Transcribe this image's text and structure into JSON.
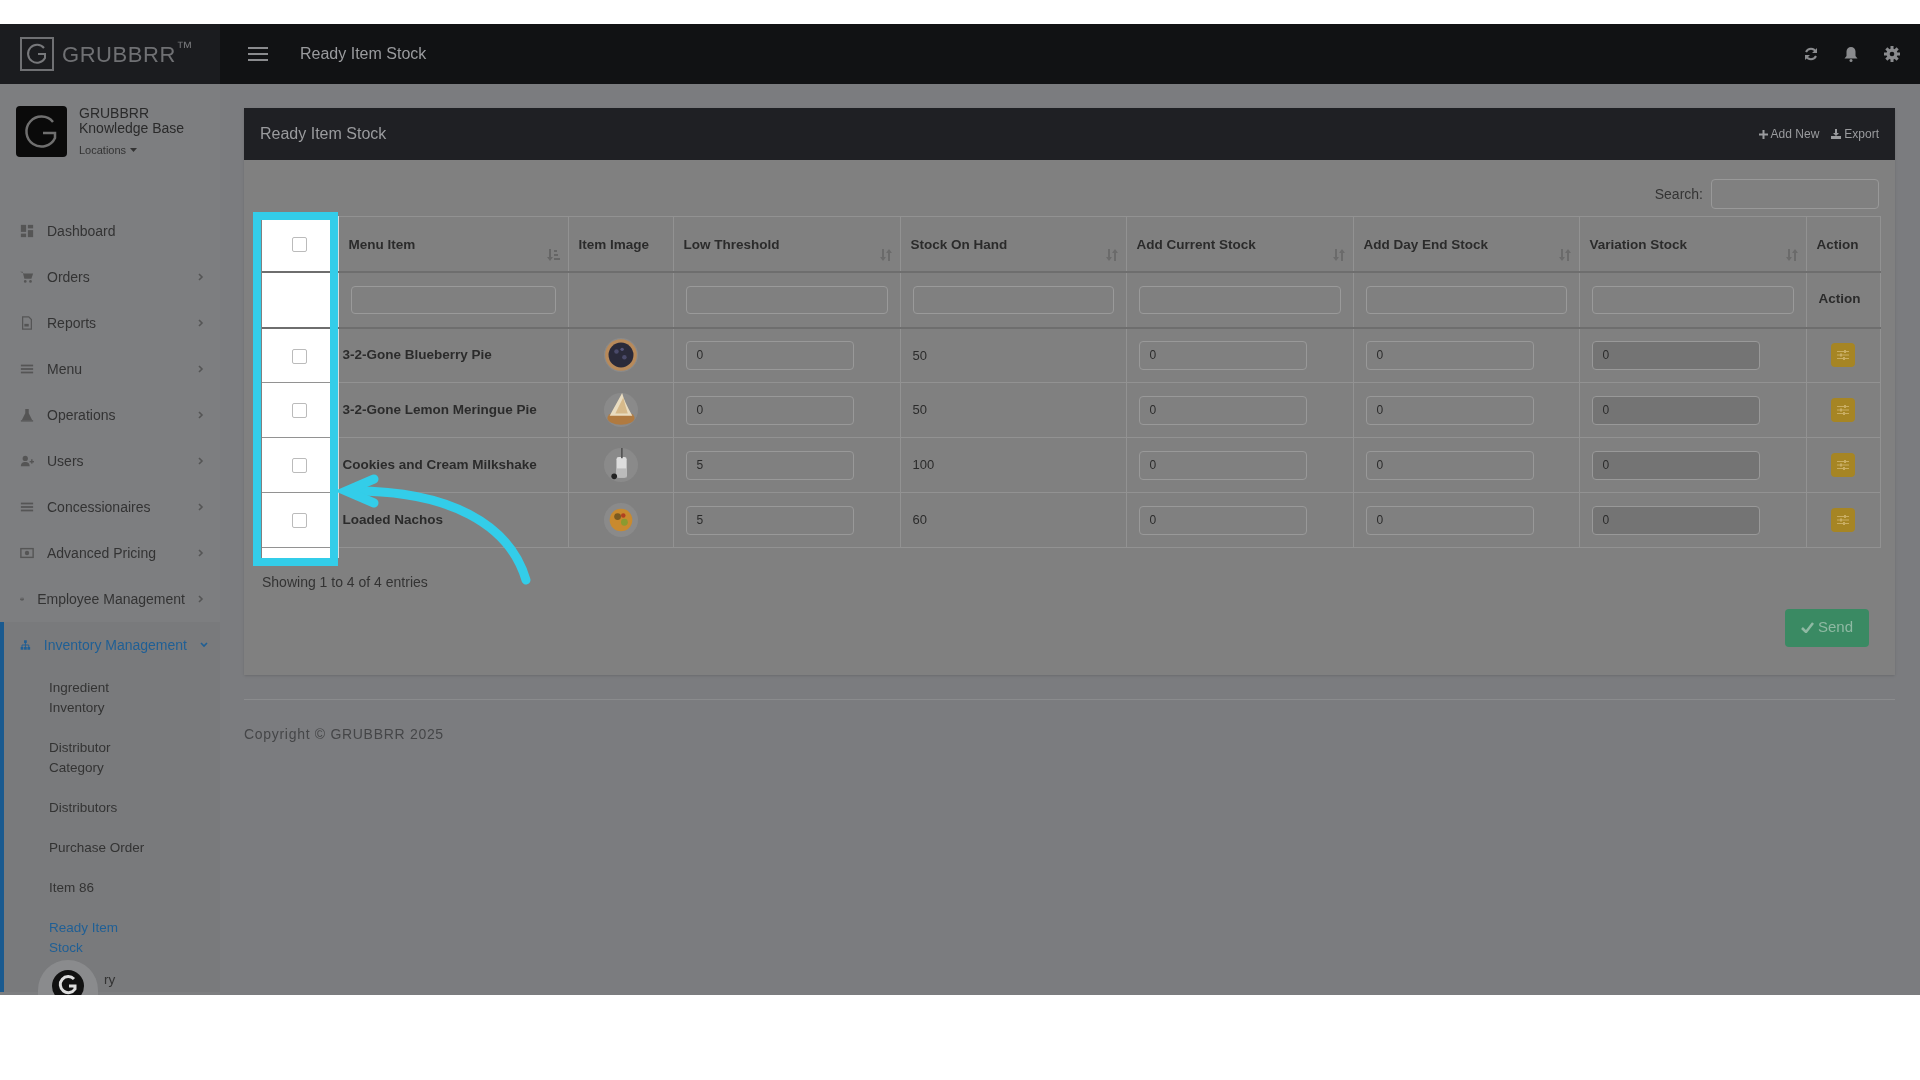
{
  "brand": {
    "logo_text": "GRUBBRR$^{™}$"
  },
  "profile": {
    "name": "GRUBBRR Knowledge Base",
    "locations": "Locations"
  },
  "sidebar": {
    "items": [
      {
        "label": "Dashboard",
        "selected": false
      },
      {
        "label": "Orders",
        "selected": false
      },
      {
        "label": "Reports",
        "selected": false
      },
      {
        "label": "Menu",
        "selected": false
      },
      {
        "label": "Operations",
        "selected": false
      },
      {
        "label": "Users",
        "selected": false
      },
      {
        "label": "Concessionaires",
        "selected": false
      },
      {
        "label": "Advanced Pricing",
        "selected": false
      },
      {
        "label": "Employee Management",
        "selected": false
      },
      {
        "label": "Inventory Management",
        "selected": true,
        "children": [
          {
            "label": "Ingredient Inventory",
            "selected": false
          },
          {
            "label": "Distributor Category",
            "selected": false
          },
          {
            "label": "Distributors",
            "selected": false
          },
          {
            "label": "Purchase Order",
            "selected": false
          },
          {
            "label": "Item 86",
            "selected": false
          },
          {
            "label": "Ready Item Stock",
            "selected": true
          },
          {
            "label": "ry",
            "selected": false
          }
        ]
      }
    ]
  },
  "topbar": {
    "title": "Ready Item Stock"
  },
  "panel": {
    "title": "Ready Item Stock",
    "actions": [
      {
        "label": "Add New"
      },
      {
        "label": "Export"
      }
    ],
    "search": {
      "label": "Search:"
    },
    "table": {
      "select_all": {
        "checked": false
      },
      "columns": [
        {
          "label": "Menu Item"
        },
        {
          "label": "Item Image"
        },
        {
          "label": "Low Threshold"
        },
        {
          "label": "Stock On Hand"
        },
        {
          "label": "Add Current Stock"
        },
        {
          "label": "Add Day End Stock"
        },
        {
          "label": "Variation Stock"
        },
        {
          "label": "Action"
        }
      ],
      "filter_action_label": "Action",
      "rows": [
        {
          "checked": false,
          "menu_item": "3-2-Gone Blueberry Pie",
          "low_threshold": "0",
          "stock_on_hand": "50",
          "add_current_stock": "0",
          "add_day_end_stock": "0",
          "variation_stock": "0"
        },
        {
          "checked": false,
          "menu_item": "3-2-Gone Lemon Meringue Pie",
          "low_threshold": "0",
          "stock_on_hand": "50",
          "add_current_stock": "0",
          "add_day_end_stock": "0",
          "variation_stock": "0"
        },
        {
          "checked": false,
          "menu_item": "Cookies and Cream Milkshake",
          "low_threshold": "5",
          "stock_on_hand": "100",
          "add_current_stock": "0",
          "add_day_end_stock": "0",
          "variation_stock": "0"
        },
        {
          "checked": false,
          "menu_item": "Loaded Nachos",
          "low_threshold": "5",
          "stock_on_hand": "60",
          "add_current_stock": "0",
          "add_day_end_stock": "0",
          "variation_stock": "0"
        }
      ]
    },
    "info": "Showing 1 to 4 of 4 entries",
    "send": "Send"
  },
  "footer": {
    "copyright": "Copyright © GRUBBRR 2025"
  }
}
